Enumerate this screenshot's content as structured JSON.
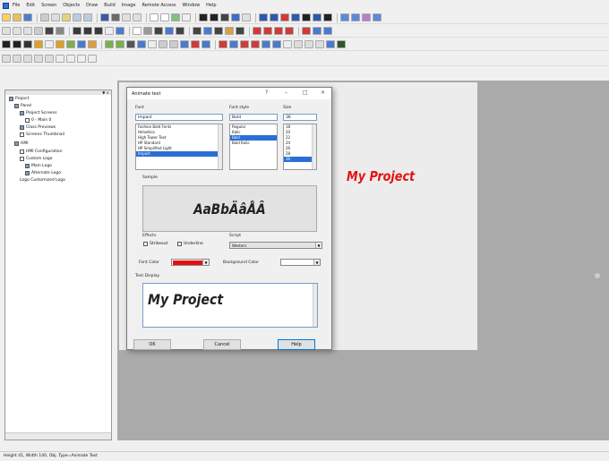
{
  "menu": [
    "File",
    "Edit",
    "Screen",
    "Objects",
    "Draw",
    "Build",
    "Image",
    "Remote Access",
    "Window",
    "Help"
  ],
  "tree": {
    "header": "▼ ×",
    "nodes": [
      "Project",
      "Panel",
      "Project Screens",
      "0 - Main 0",
      "Class Previews",
      "Screens Thumbnail",
      "HMI",
      "HMI Configuration",
      "Custom Logo",
      "Main Logo",
      "Alternate Logo",
      "Logo Customized Logo"
    ]
  },
  "canvas": {
    "text": "My Project",
    "text_color": "#e31212"
  },
  "status": "Height 41, Width 140, Obj. Type=Animate Text",
  "dialog": {
    "title": "Animate text",
    "font_label": "Font",
    "font_value": "Impact",
    "style_label": "Font style",
    "style_value": "Bold",
    "size_label": "Size",
    "size_value": "36",
    "fonts": [
      "Fashion Bold Fonts",
      "Helvetica",
      "High Tower Text",
      "HP Standard",
      "HP Simplified Light",
      "Impact"
    ],
    "styles": [
      "Regular",
      "Italic",
      "Bold",
      "Bold Italic"
    ],
    "sizes": [
      "18",
      "20",
      "22",
      "24",
      "26",
      "28",
      "36"
    ],
    "sample_label": "Sample",
    "sample_text": "AaBbÄâÅÂ",
    "effects_label": "Effects",
    "strikeout": "Strikeout",
    "underline": "Underline",
    "script_label": "Script",
    "script_value": "Western",
    "font_color_label": "Font Color",
    "font_color": "#e31212",
    "bg_color_label": "Background Color",
    "text_display_label": "Text Display",
    "text_value": "My Project",
    "ok": "OK",
    "cancel": "Cancel",
    "help": "Help"
  }
}
